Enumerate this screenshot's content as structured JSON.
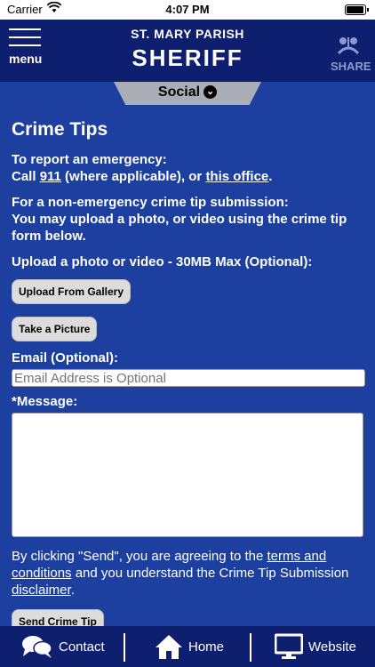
{
  "status_bar": {
    "carrier": "Carrier",
    "time": "4:07 PM"
  },
  "header": {
    "menu_label": "menu",
    "parish": "ST. MARY PARISH",
    "sheriff": "SHERIFF",
    "share_label": "SHARE"
  },
  "social_tab": {
    "label": "Social"
  },
  "page": {
    "title": "Crime Tips",
    "emergency_heading": "To report an emergency:",
    "emergency_call_prefix": "Call ",
    "emergency_number": "911",
    "emergency_middle": " (where applicable), or ",
    "emergency_office_link": "this office",
    "emergency_suffix": ".",
    "nonemergency_heading": "For a non-emergency crime tip submission:",
    "nonemergency_body": "You may upload a photo, or video using the crime tip form below.",
    "upload_label": "Upload a photo or video - 30MB Max (Optional):",
    "upload_gallery_button": "Upload From Gallery",
    "take_picture_button": "Take a Picture",
    "email_label": "Email (Optional):",
    "email_placeholder": "Email Address is Optional",
    "message_label": "*Message:",
    "legal_prefix": "By clicking \"Send\", you are agreeing to the ",
    "legal_terms_link": "terms and conditions",
    "legal_middle": " and you understand the Crime Tip Submission ",
    "legal_disclaimer_link": "disclaimer",
    "legal_suffix": ".",
    "send_button": "Send Crime Tip"
  },
  "bottom_nav": {
    "contact": "Contact",
    "home": "Home",
    "website": "Website"
  },
  "colors": {
    "background": "#1c3fa0",
    "header": "#0d1f6e",
    "tab": "#a9adb5"
  }
}
